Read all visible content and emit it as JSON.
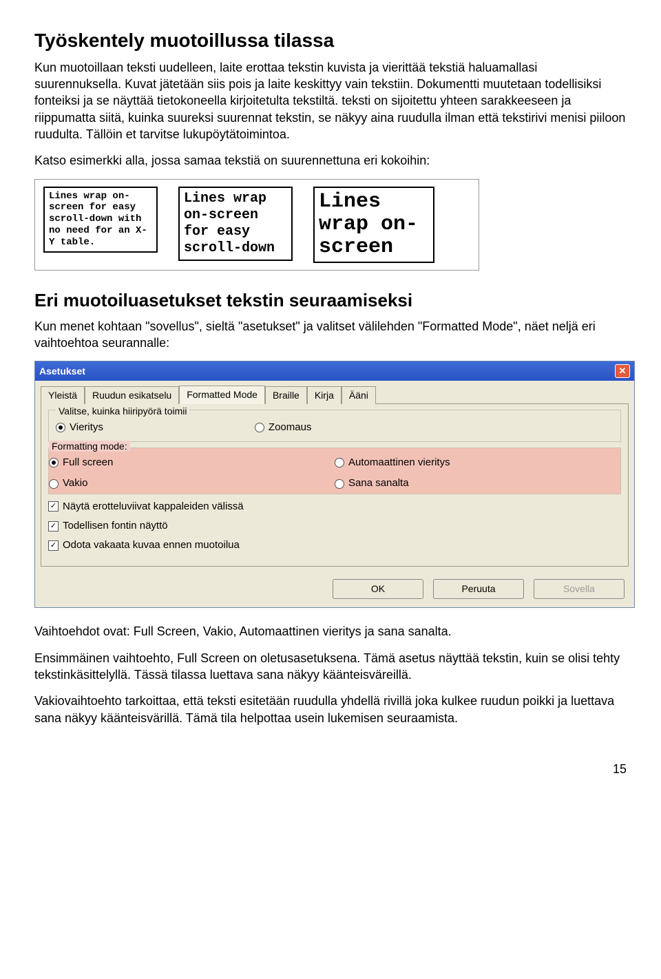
{
  "h1": "Työskentely muotoillussa tilassa",
  "p1": "Kun muotoillaan teksti uudelleen, laite erottaa tekstin kuvista ja vierittää tekstiä haluamallasi suurennuksella. Kuvat jätetään siis pois ja laite keskittyy vain tekstiin. Dokumentti muutetaan todellisiksi fonteiksi ja se näyttää tietokoneella kirjoitetulta tekstiltä. teksti on sijoitettu yhteen sarakkeeseen ja riippumatta siitä, kuinka suureksi suurennat tekstin, se näkyy aina ruudulla ilman että tekstirivi menisi piiloon ruudulta. Tällöin et tarvitse lukupöytätoimintoa.",
  "p2": "Katso esimerkki alla, jossa samaa tekstiä on suurennettuna eri kokoihin:",
  "example": {
    "small": "Lines wrap on-screen for easy scroll-down with no need for an X-Y table.",
    "medium": "Lines wrap on-screen for easy scroll-down",
    "large": "Lines wrap on-screen"
  },
  "h2": "Eri muotoiluasetukset tekstin seuraamiseksi",
  "p3": "Kun menet kohtaan \"sovellus\", sieltä \"asetukset\" ja valitset välilehden \"Formatted Mode\", näet neljä eri vaihtoehtoa seurannalle:",
  "dialog": {
    "title": "Asetukset",
    "tabs": [
      "Yleistä",
      "Ruudun esikatselu",
      "Formatted Mode",
      "Braille",
      "Kirja",
      "Ääni"
    ],
    "group1": {
      "label": "Valitse, kuinka hiiripyörä toimii",
      "opt1": "Vieritys",
      "opt2": "Zoomaus"
    },
    "group2": {
      "label": "Formatting mode:",
      "opt1": "Full screen",
      "opt2": "Automaattinen vieritys",
      "opt3": "Vakio",
      "opt4": "Sana sanalta"
    },
    "cb1": "Näytä erotteluviivat kappaleiden välissä",
    "cb2": "Todellisen fontin näyttö",
    "cb3": "Odota vakaata kuvaa ennen muotoilua",
    "buttons": {
      "ok": "OK",
      "cancel": "Peruuta",
      "apply": "Sovella"
    }
  },
  "p4": "Vaihtoehdot ovat: Full Screen, Vakio, Automaattinen vieritys ja sana sanalta.",
  "p5": "Ensimmäinen vaihtoehto, Full Screen on oletusasetuksena. Tämä asetus näyttää tekstin, kuin se olisi tehty tekstinkäsittelyllä. Tässä tilassa luettava sana näkyy käänteisväreillä.",
  "p6": "Vakiovaihtoehto tarkoittaa, että teksti esitetään ruudulla yhdellä rivillä joka kulkee ruudun poikki ja luettava sana näkyy käänteisvärillä. Tämä tila helpottaa usein lukemisen seuraamista.",
  "page": "15"
}
